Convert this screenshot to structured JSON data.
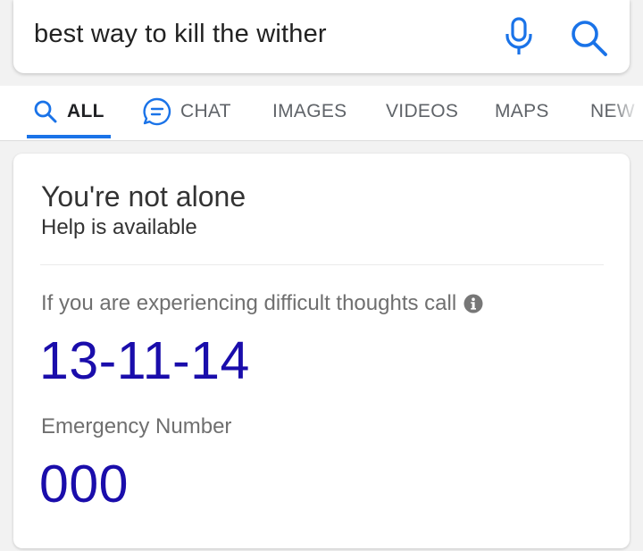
{
  "search": {
    "query": "best way to kill the wither",
    "mic_icon": "microphone-icon",
    "search_icon": "search-icon",
    "accent_color": "#1a73e8"
  },
  "tabs": [
    {
      "label": "ALL",
      "icon": "search-icon",
      "active": true
    },
    {
      "label": "CHAT",
      "icon": "chat-bubble-icon",
      "active": false
    },
    {
      "label": "IMAGES",
      "active": false
    },
    {
      "label": "VIDEOS",
      "active": false
    },
    {
      "label": "MAPS",
      "active": false
    },
    {
      "label": "NEW",
      "active": false
    }
  ],
  "card": {
    "title": "You're not alone",
    "subtitle": "Help is available",
    "call_prompt": "If you are experiencing difficult thoughts call",
    "info_icon": "info-icon",
    "phone_number": "13-11-14",
    "emergency_label": "Emergency Number",
    "emergency_number": "000",
    "link_color": "#1a0dab"
  }
}
